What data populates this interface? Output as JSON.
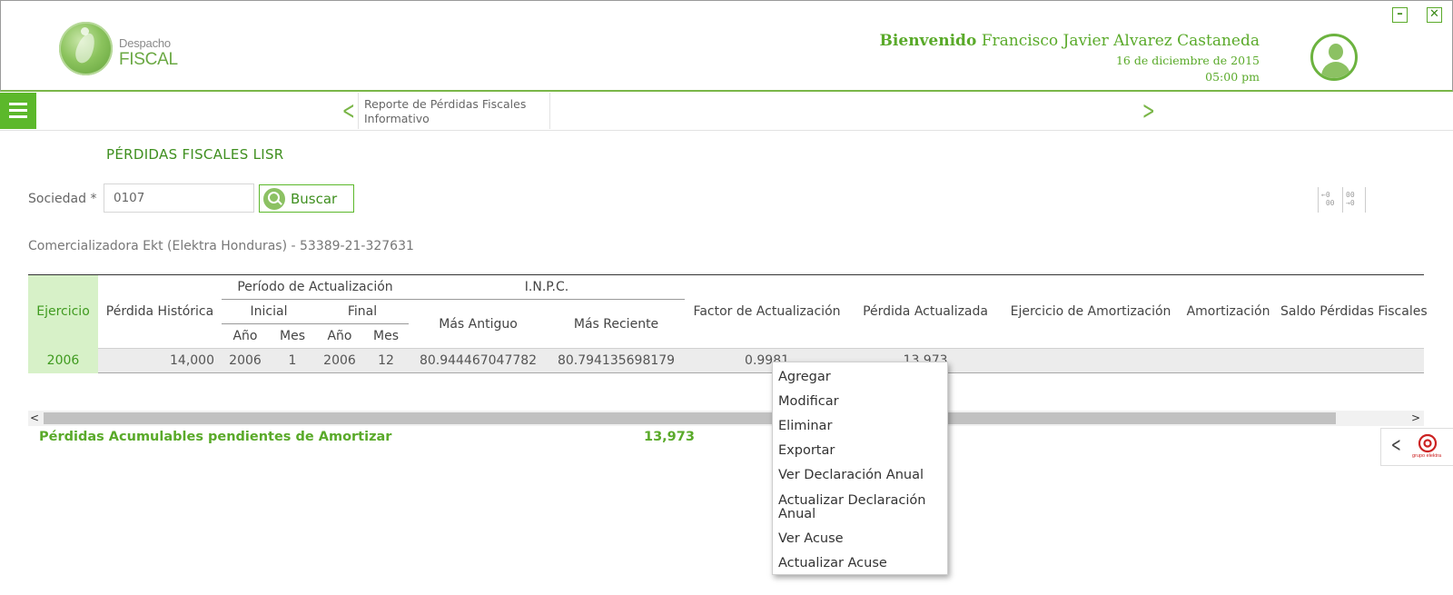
{
  "header": {
    "logo": {
      "line1": "Despacho",
      "line2": "FISCAL"
    },
    "welcome_label": "Bienvenido",
    "user_name": "Francisco Javier Alvarez Castaneda",
    "date": "16 de diciembre de 2015",
    "time": "05:00 pm",
    "minimize_glyph": "–",
    "close_glyph": "✕"
  },
  "nav": {
    "tab_line1": "Reporte de Pérdidas Fiscales",
    "tab_line2": "Informativo",
    "prev_glyph": "<",
    "next_glyph": ">"
  },
  "page": {
    "title": "PÉRDIDAS FISCALES LISR",
    "sociedad_label": "Sociedad *",
    "sociedad_value": "0107",
    "buscar_label": "Buscar",
    "company_line": "Comercializadora Ekt (Elektra Honduras) - 53389-21-327631",
    "col_ctrl1": "←0\n 00",
    "col_ctrl2": "00\n→0"
  },
  "table": {
    "headers": {
      "ejercicio": "Ejercicio",
      "perdida_historica": "Pérdida Histórica",
      "periodo": "Período de Actualización",
      "inpc": "I.N.P.C.",
      "inicial": "Inicial",
      "final": "Final",
      "anio1": "Año",
      "mes1": "Mes",
      "anio2": "Año",
      "mes2": "Mes",
      "mas_antiguo": "Más Antiguo",
      "mas_reciente": "Más Reciente",
      "factor": "Factor de Actualización",
      "perdida_actualizada": "Pérdida Actualizada",
      "ejercicio_amortizacion": "Ejercicio de Amortización",
      "amortizacion": "Amortización",
      "saldo": "Saldo Pérdidas Fiscales"
    },
    "rows": [
      {
        "ejercicio": "2006",
        "perdida_historica": "14,000",
        "anio_inicial": "2006",
        "mes_inicial": "1",
        "anio_final": "2006",
        "mes_final": "12",
        "mas_antiguo": "80.944467047782",
        "mas_reciente": "80.794135698179",
        "factor": "0.9981",
        "perdida_actualizada": "13,973",
        "ejercicio_amortizacion": "",
        "amortizacion": "",
        "saldo": ""
      }
    ]
  },
  "scroll": {
    "left_glyph": "<",
    "right_glyph": ">"
  },
  "summary": {
    "label": "Pérdidas Acumulables pendientes de Amortizar",
    "value": "13,973"
  },
  "side_tab": {
    "brand_text": "grupo elektra",
    "chevron": "<"
  },
  "context_menu": {
    "items": [
      "Agregar",
      "Modificar",
      "Eliminar",
      "Exportar",
      "Ver Declaración Anual",
      "Actualizar Declaración Anual",
      "Ver Acuse",
      "Actualizar Acuse"
    ]
  },
  "colors": {
    "brand_green": "#5cb82b",
    "dark_green": "#3f8f1f",
    "ejercicio_bg": "#d7f1c8",
    "brand_red": "#cc2222"
  }
}
